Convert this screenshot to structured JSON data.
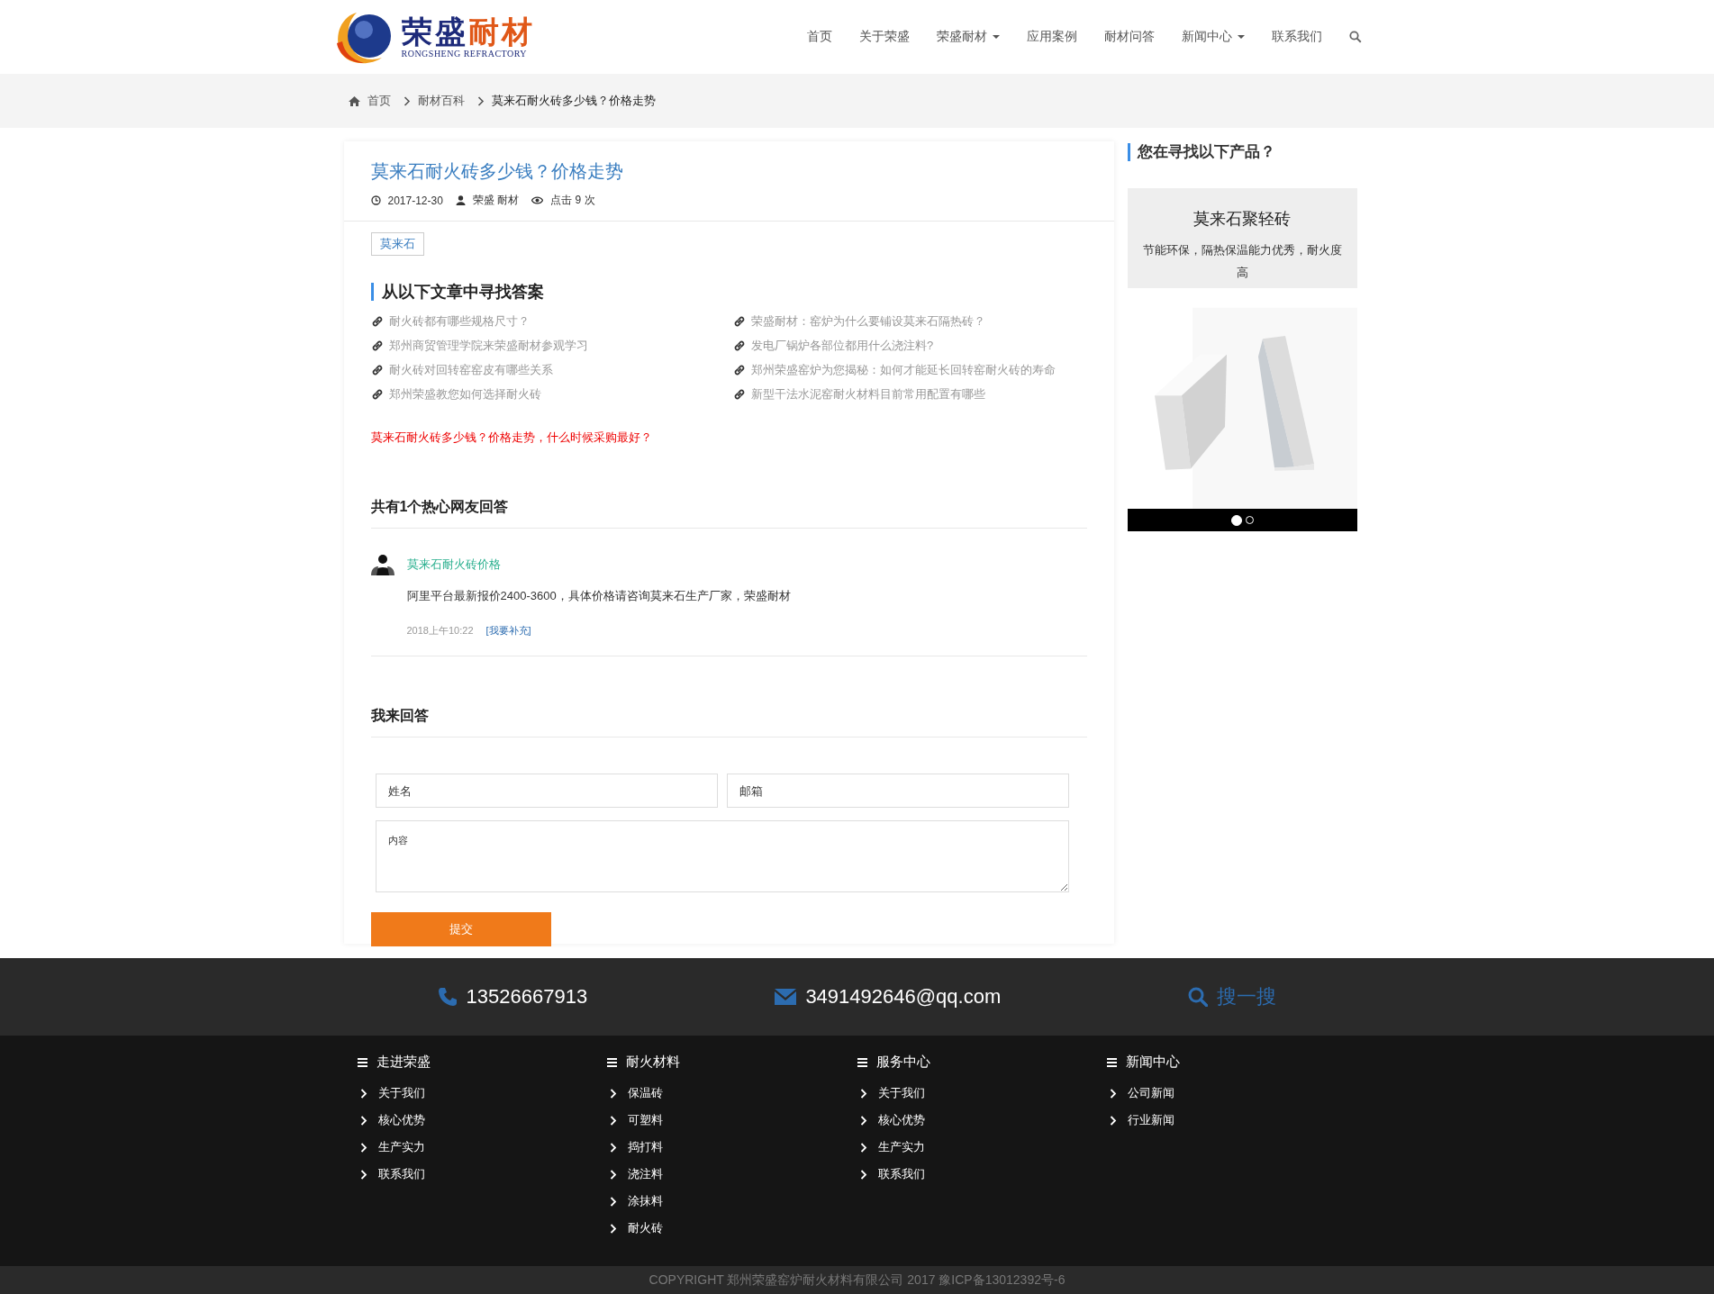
{
  "logo": {
    "name": "荣盛",
    "name_accent": "耐材",
    "subtitle": "RONGSHENG  REFRACTORY"
  },
  "nav": [
    {
      "label": "首页",
      "dropdown": false
    },
    {
      "label": "关于荣盛",
      "dropdown": false
    },
    {
      "label": "荣盛耐材",
      "dropdown": true
    },
    {
      "label": "应用案例",
      "dropdown": false
    },
    {
      "label": "耐材问答",
      "dropdown": false
    },
    {
      "label": "新闻中心",
      "dropdown": true
    },
    {
      "label": "联系我们",
      "dropdown": false
    }
  ],
  "breadcrumb": [
    "首页",
    "耐材百科",
    "莫来石耐火砖多少钱？价格走势"
  ],
  "article": {
    "title": "莫来石耐火砖多少钱？价格走势",
    "date": "2017-12-30",
    "author": "荣盛 耐材",
    "views": "点击 9 次",
    "tag": "莫来石",
    "related_heading": "从以下文章中寻找答案",
    "related": [
      "耐火砖都有哪些规格尺寸？",
      "荣盛耐材：窑炉为什么要铺设莫来石隔热砖？",
      "郑州商贸管理学院来荣盛耐材参观学习",
      "发电厂锅炉各部位都用什么浇注料?",
      "耐火砖对回转窑窑皮有哪些关系",
      "郑州荣盛窑炉为您揭秘：如何才能延长回转窑耐火砖的寿命",
      "郑州荣盛教您如何选择耐火砖",
      "新型干法水泥窑耐火材料目前常用配置有哪些"
    ],
    "question": "莫来石耐火砖多少钱？价格走势，什么时候采购最好？"
  },
  "answers": {
    "heading": "共有1个热心网友回答",
    "items": [
      {
        "name": "莫来石耐火砖价格",
        "text": "阿里平台最新报价2400-3600，具体价格请咨询莫来石生产厂家，荣盛耐材",
        "time": "2018上午10:22",
        "action": "[我要补充]"
      }
    ]
  },
  "reply_form": {
    "heading": "我来回答",
    "name_placeholder": "姓名",
    "email_placeholder": "邮箱",
    "content_placeholder": "内容",
    "submit": "提交"
  },
  "sidebar": {
    "heading": "您在寻找以下产品？",
    "product": {
      "name": "莫来石聚轻砖",
      "description": "节能环保，隔热保温能力优秀，耐火度高"
    },
    "slides": [
      {
        "selected": true
      },
      {
        "selected": false
      }
    ]
  },
  "contact_bar": {
    "phone": "13526667913",
    "email": "3491492646@qq.com",
    "search": "搜一搜"
  },
  "footer_columns": [
    {
      "title": "走进荣盛",
      "links": [
        "关于我们",
        "核心优势",
        "生产实力",
        "联系我们"
      ]
    },
    {
      "title": "耐火材料",
      "links": [
        "保温砖",
        "可塑料",
        "捣打料",
        "浇注料",
        "涂抹料",
        "耐火砖"
      ]
    },
    {
      "title": "服务中心",
      "links": [
        "关于我们",
        "核心优势",
        "生产实力",
        "联系我们"
      ]
    },
    {
      "title": "新闻中心",
      "links": [
        "公司新闻",
        "行业新闻"
      ]
    }
  ],
  "copyright": "COPYRIGHT 郑州荣盛窑炉耐火材料有限公司 2017 豫ICP备13012392号-6"
}
